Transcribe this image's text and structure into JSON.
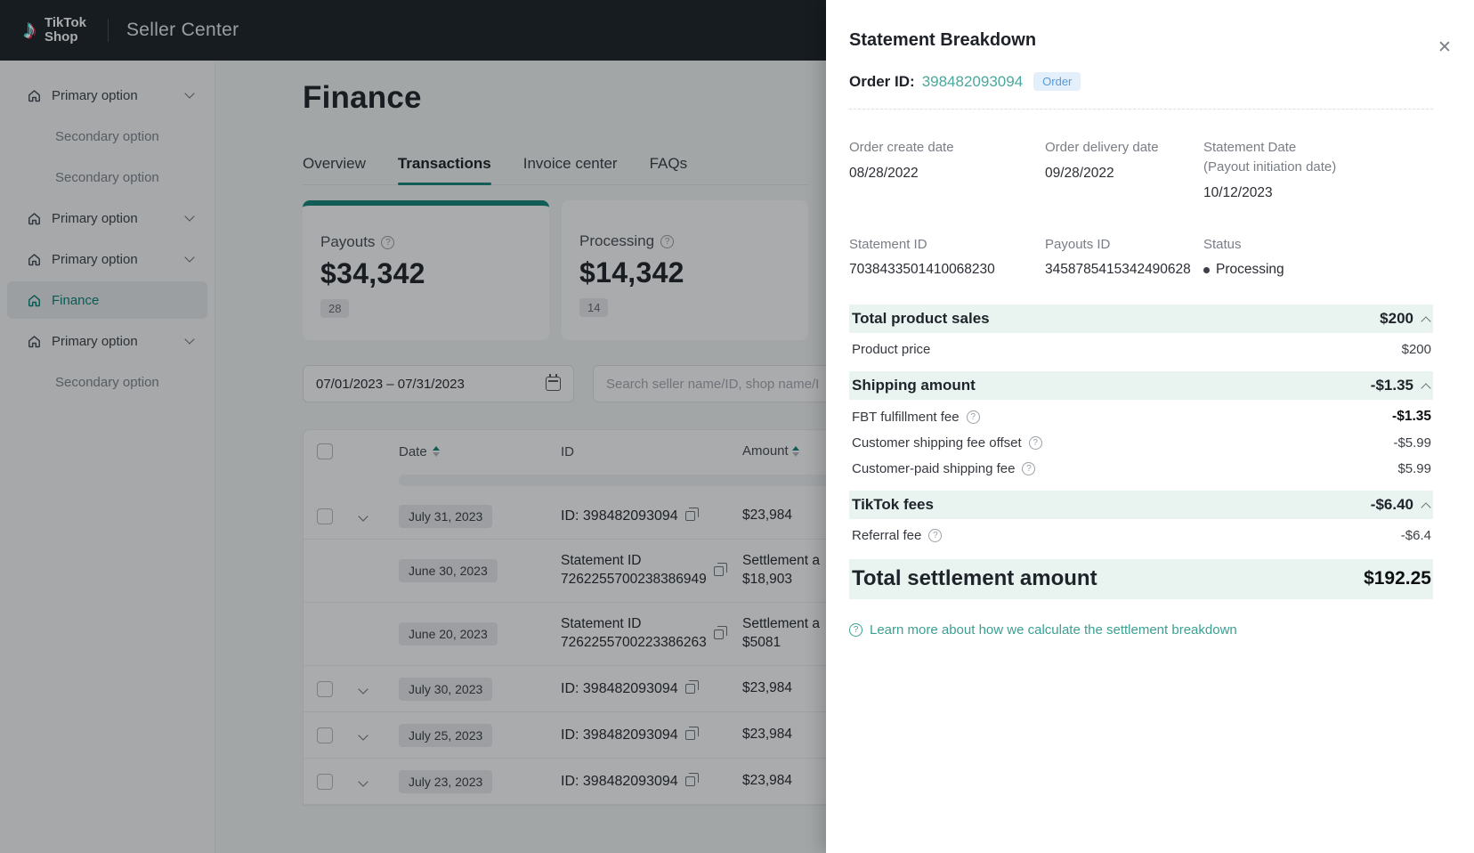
{
  "colors": {
    "accent_teal": "#17887b",
    "link_teal": "#4aa89c",
    "mint_section_bg": "#e9f4f1",
    "order_badge_bg": "#e3effa",
    "order_badge_text": "#5a9ad2",
    "topbar_bg": "#20242a"
  },
  "header": {
    "logo_line1": "TikTok",
    "logo_line2": "Shop",
    "product": "Seller Center"
  },
  "sidebar": {
    "items": [
      {
        "label": "Primary option"
      },
      {
        "label": "Secondary option"
      },
      {
        "label": "Secondary option"
      },
      {
        "label": "Primary option"
      },
      {
        "label": "Primary option"
      },
      {
        "label": "Finance"
      },
      {
        "label": "Primary option"
      },
      {
        "label": "Secondary option"
      }
    ]
  },
  "main": {
    "title": "Finance",
    "tabs": [
      {
        "label": "Overview"
      },
      {
        "label": "Transactions"
      },
      {
        "label": "Invoice center"
      },
      {
        "label": "FAQs"
      }
    ],
    "cards": [
      {
        "label": "Payouts",
        "value": "$34,342",
        "count": "28"
      },
      {
        "label": "Processing",
        "value": "$14,342",
        "count": "14"
      }
    ],
    "filters": {
      "date_range": "07/01/2023  –  07/31/2023",
      "search_placeholder": "Search seller name/ID, shop name/I"
    },
    "table": {
      "columns": {
        "date": "Date",
        "id": "ID",
        "amount": "Amount"
      },
      "rows": [
        {
          "date": "July 31, 2023",
          "id": "ID: 398482093094",
          "amount": "$23,984"
        },
        {
          "date": "June 30, 2023",
          "id_line1": "Statement ID",
          "id_line2": "7262255700238386949",
          "amount_line1": "Settlement a",
          "amount_line2": "$18,903"
        },
        {
          "date": "June 20, 2023",
          "id_line1": "Statement ID",
          "id_line2": "7262255700223386263",
          "amount_line1": "Settlement a",
          "amount_line2": "$5081"
        },
        {
          "date": "July 30, 2023",
          "id": "ID: 398482093094",
          "amount": "$23,984"
        },
        {
          "date": "July 25, 2023",
          "id": "ID: 398482093094",
          "amount": "$23,984"
        },
        {
          "date": "July 23, 2023",
          "id": "ID: 398482093094",
          "amount": "$23,984"
        }
      ]
    }
  },
  "drawer": {
    "title": "Statement Breakdown",
    "order_id_label": "Order ID:",
    "order_id": "398482093094",
    "order_badge": "Order",
    "details": [
      {
        "label": "Order create date",
        "value": "08/28/2022"
      },
      {
        "label": "Order delivery date",
        "value": "09/28/2022"
      },
      {
        "label": "Statement Date",
        "label2": "(Payout initiation date)",
        "value": "10/12/2023"
      },
      {
        "label": "Statement ID",
        "value": "7038433501410068230"
      },
      {
        "label": "Payouts ID",
        "value": "3458785415342490628"
      },
      {
        "label": "Status",
        "value": "Processing"
      }
    ],
    "sections": [
      {
        "header": "Total product sales",
        "amount": "$200",
        "rows": [
          {
            "label": "Product price",
            "value": "$200"
          }
        ]
      },
      {
        "header": "Shipping amount",
        "amount": "-$1.35",
        "rows": [
          {
            "label": "FBT fulfillment fee",
            "value": "-$1.35"
          },
          {
            "label": "Customer shipping fee offset",
            "value": "-$5.99"
          },
          {
            "label": "Customer-paid shipping fee",
            "value": "$5.99"
          }
        ]
      },
      {
        "header": "TikTok fees",
        "amount": "-$6.40",
        "rows": [
          {
            "label": "Referral fee",
            "value": "-$6.4"
          }
        ]
      }
    ],
    "total": {
      "label": "Total settlement amount",
      "value": "$192.25"
    },
    "learn_more": "Learn more about how we calculate the settlement breakdown"
  }
}
